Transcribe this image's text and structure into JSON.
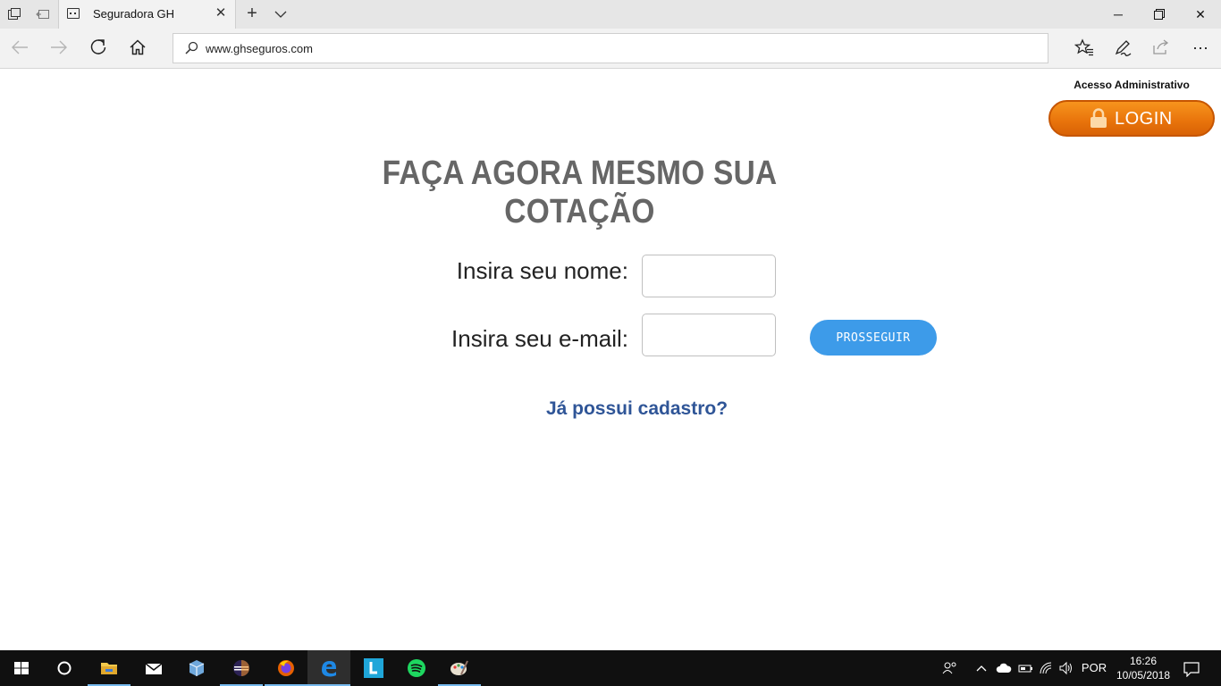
{
  "browser": {
    "tab_title": "Seguradora GH",
    "address": "www.ghseguros.com"
  },
  "page": {
    "admin_label": "Acesso Administrativo",
    "login_label": "LOGIN",
    "headline": "FAÇA AGORA MESMO SUA COTAÇÃO",
    "name_label": "Insira seu nome:",
    "name_value": "",
    "email_label": "Insira seu e-mail:",
    "email_value": "",
    "proceed_label": "PROSSEGUIR",
    "register_link": "Já possui cadastro?",
    "colors": {
      "login_orange": "#e8730b",
      "proceed_blue": "#3d9be9",
      "link_blue": "#2f5597",
      "headline_gray": "#666666"
    }
  },
  "taskbar": {
    "icons": [
      "windows-start",
      "cortana-search",
      "file-explorer",
      "mail",
      "virtualbox",
      "eclipse",
      "firefox",
      "edge",
      "l-app",
      "spotify",
      "paint"
    ],
    "active": "edge",
    "language": "POR",
    "time": "16:26",
    "date": "10/05/2018"
  }
}
